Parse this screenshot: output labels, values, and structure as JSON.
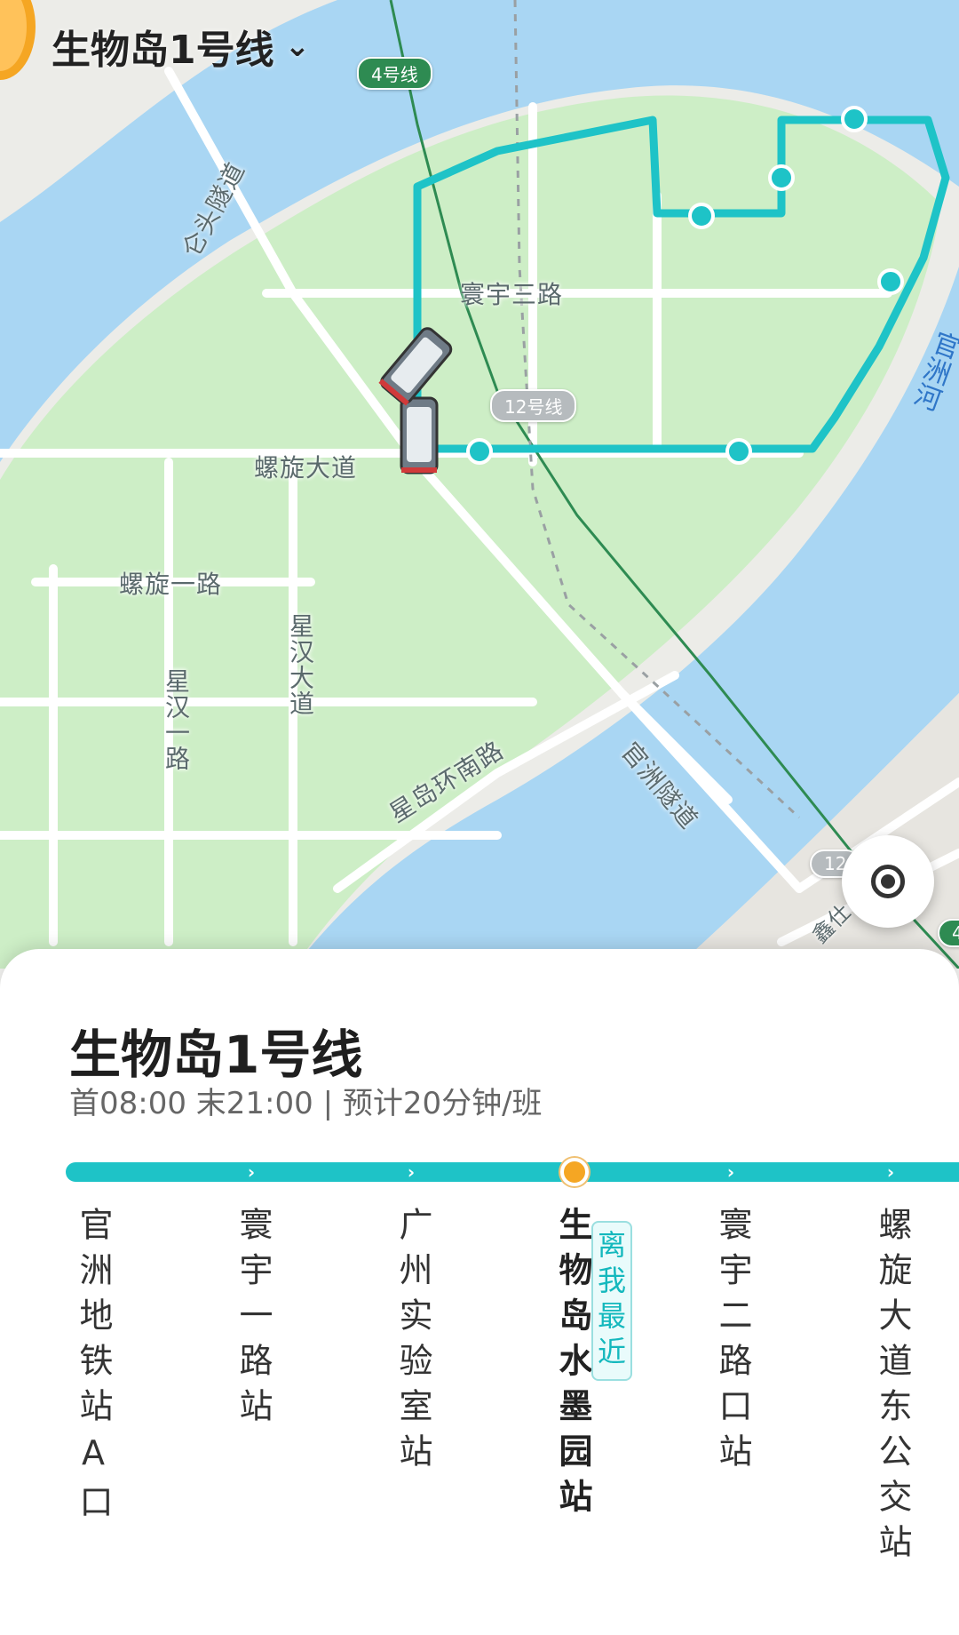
{
  "header": {
    "route_title": "生物岛1号线",
    "dropdown_icon": "chevron-down-icon"
  },
  "map": {
    "road_labels": {
      "huanyu_3rd_road": "寰宇三路",
      "luoxuan_avenue": "螺旋大道",
      "luoxuan_1st_road": "螺旋一路",
      "xinghan_avenue": "星汉大道",
      "xinghan_1st_road": "星汉一路",
      "xingdao_south_ring": "星岛环南路",
      "guanzhou_tunnel": "官洲隧道",
      "luntou_tunnel": "仑头隧道",
      "river_name": "官洲河",
      "lower_right_partial": "鑫仕"
    },
    "metro_badges": {
      "line4_top": "4号线",
      "line12_center": "12号线",
      "line12_bottom_partial": "12",
      "line4_edge_partial": "4"
    },
    "colors": {
      "route_line": "#1ec3c7",
      "metro_line4": "#2e8b52",
      "river": "#a9d6f3",
      "island_green": "#cdeec6",
      "current_stop": "#f5a623"
    },
    "locate_icon": "locate-target-icon"
  },
  "panel": {
    "title": "生物岛1号线",
    "schedule": "首08:00 末21:00 | 预计20分钟/班",
    "nearest_tag": "离我最近",
    "stops": [
      {
        "name": "官洲地铁站A口",
        "current": false
      },
      {
        "name": "寰宇一路站",
        "current": false
      },
      {
        "name": "广州实验室站",
        "current": false
      },
      {
        "name": "生物岛水墨园站",
        "current": true
      },
      {
        "name": "寰宇二路口站",
        "current": false
      },
      {
        "name": "螺旋大道东公交站",
        "current": false
      }
    ]
  }
}
